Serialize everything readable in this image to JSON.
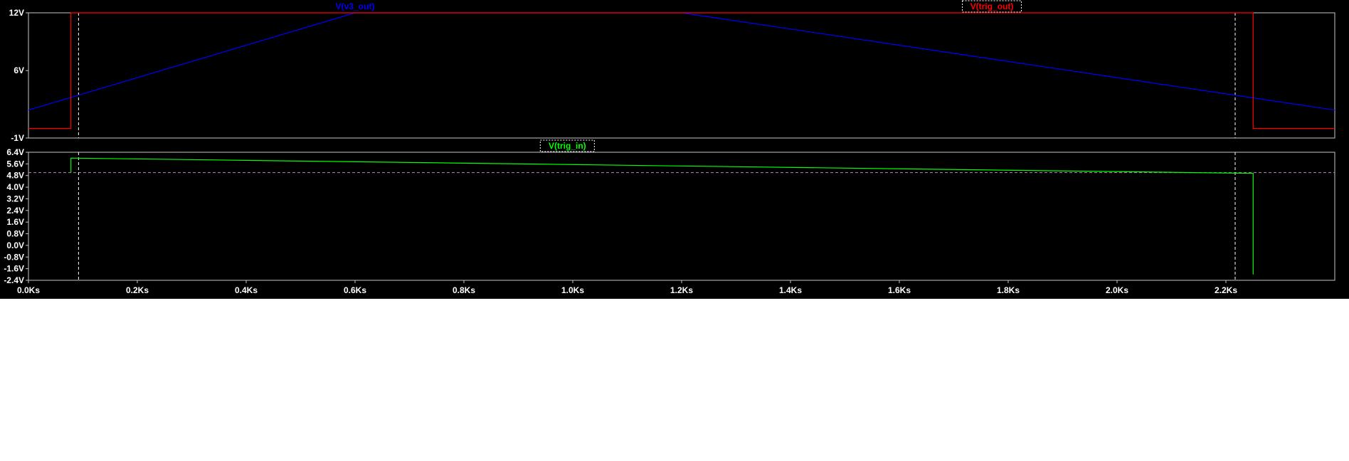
{
  "colors": {
    "background": "#000000",
    "frame": "#c8c8c8",
    "tick_text": "#ffffff",
    "cursor": "#ffffff",
    "ref_line": "#c080c0"
  },
  "chart_data": [
    {
      "type": "line",
      "pane": "top",
      "title": "",
      "xlabel": "",
      "ylabel": "",
      "xlim": [
        0,
        2.4
      ],
      "ylim": [
        -1,
        12
      ],
      "yticks": [
        "12V",
        "6V",
        "-1V"
      ],
      "ytick_values": [
        12,
        6,
        -1
      ],
      "series": [
        {
          "name": "V(v3_out)",
          "color": "#0000ff",
          "label_boxed": false,
          "x": [
            0,
            0.6,
            1.2,
            2.4
          ],
          "y": [
            1.9,
            12,
            12,
            1.9
          ]
        },
        {
          "name": "V(trig_out)",
          "color": "#ff0000",
          "label_boxed": true,
          "x": [
            0,
            0.078,
            0.078,
            2.25,
            2.25,
            2.4
          ],
          "y": [
            0,
            0,
            12,
            12,
            0,
            0
          ]
        }
      ]
    },
    {
      "type": "line",
      "pane": "bottom",
      "title": "",
      "xlabel": "",
      "ylabel": "",
      "xlim": [
        0,
        2.4
      ],
      "ylim": [
        -2.4,
        6.4
      ],
      "yticks": [
        "6.4V",
        "5.6V",
        "4.8V",
        "4.0V",
        "3.2V",
        "2.4V",
        "1.6V",
        "0.8V",
        "0.0V",
        "-0.8V",
        "-1.6V",
        "-2.4V"
      ],
      "ytick_values": [
        6.4,
        5.6,
        4.8,
        4.0,
        3.2,
        2.4,
        1.6,
        0.8,
        0.0,
        -0.8,
        -1.6,
        -2.4
      ],
      "reference_level": 5.0,
      "series": [
        {
          "name": "V(trig_in)",
          "color": "#00ff00",
          "label_boxed": true,
          "x": [
            0.078,
            0.078,
            2.25,
            2.25
          ],
          "y": [
            5.0,
            6.0,
            4.95,
            -2.0
          ]
        }
      ]
    }
  ],
  "x_axis": {
    "ticks": [
      "0.0Ks",
      "0.2Ks",
      "0.4Ks",
      "0.6Ks",
      "0.8Ks",
      "1.0Ks",
      "1.2Ks",
      "1.4Ks",
      "1.6Ks",
      "1.8Ks",
      "2.0Ks",
      "2.2Ks"
    ],
    "tick_values": [
      0,
      0.2,
      0.4,
      0.6,
      0.8,
      1.0,
      1.2,
      1.4,
      1.6,
      1.8,
      2.0,
      2.2
    ]
  },
  "cursors": {
    "x_values": [
      0.092,
      2.217
    ]
  }
}
